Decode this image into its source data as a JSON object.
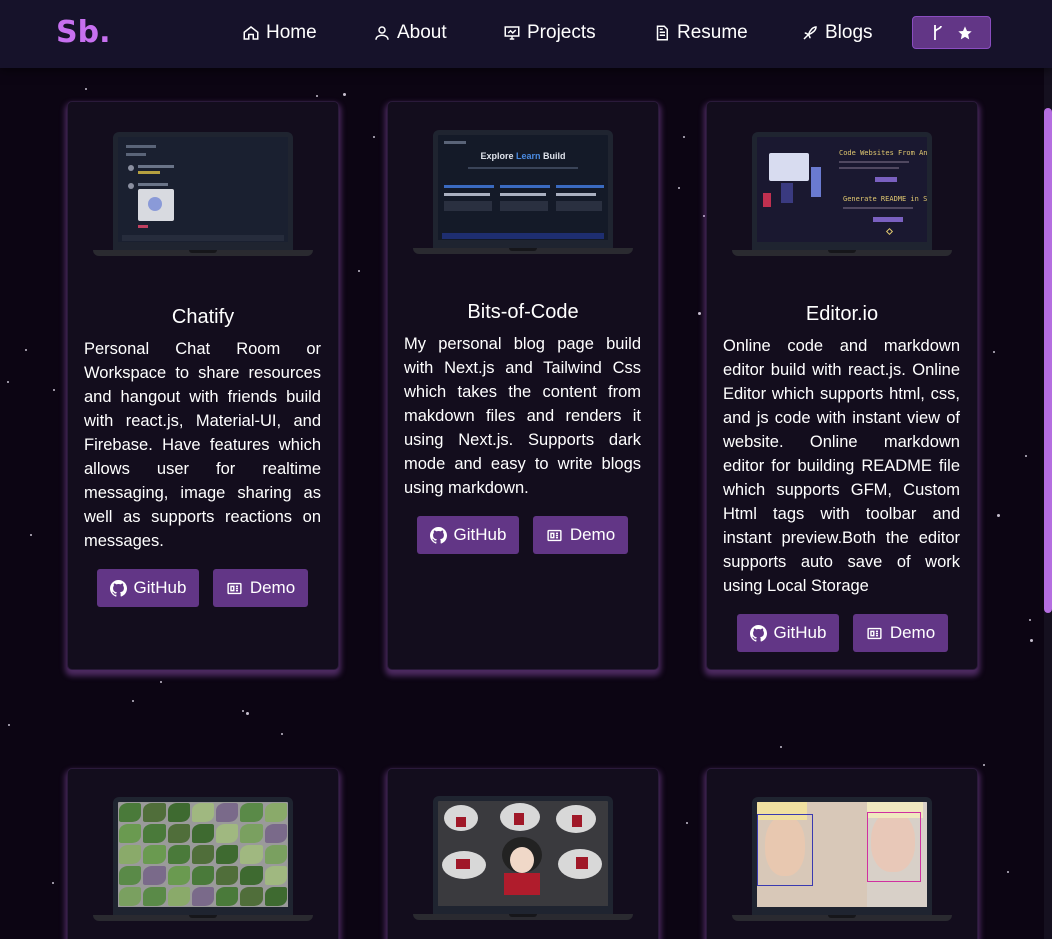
{
  "brand": {
    "name": "Sb",
    "dot": "."
  },
  "nav": [
    {
      "label": "Home",
      "icon": "home-icon"
    },
    {
      "label": "About",
      "icon": "user-icon"
    },
    {
      "label": "Projects",
      "icon": "projects-icon"
    },
    {
      "label": "Resume",
      "icon": "document-icon"
    },
    {
      "label": "Blogs",
      "icon": "blog-icon"
    }
  ],
  "nav_button": {
    "icons": [
      "fork-icon",
      "star-icon"
    ]
  },
  "colors": {
    "accent": "#c770f0",
    "button": "#623686",
    "background": "#0c0513",
    "card": "#130d1d"
  },
  "projects": [
    {
      "title": "Chatify",
      "description": "Personal Chat Room or Workspace to share resources and hangout with friends build with react.js, Material-UI, and Firebase. Have features which allows user for realtime messaging, image sharing as well as supports reactions on messages.",
      "github_label": "GitHub",
      "demo_label": "Demo"
    },
    {
      "title": "Bits-of-Code",
      "description": "My personal blog page build with Next.js and Tailwind Css which takes the content from makdown files and renders it using Next.js. Supports dark mode and easy to write blogs using markdown.",
      "github_label": "GitHub",
      "demo_label": "Demo",
      "screen_text": {
        "explore": "Explore",
        "learn": "Learn",
        "build": "Build"
      }
    },
    {
      "title": "Editor.io",
      "description": "Online code and markdown editor build with react.js. Online Editor which supports html, css, and js code with instant view of website. Online markdown editor for building README file which supports GFM, Custom Html tags with toolbar and instant preview.Both the editor supports auto save of work using Local Storage",
      "github_label": "GitHub",
      "demo_label": "Demo",
      "screen_text": {
        "heading1": "Code Websites From Any W",
        "heading2": "Generate README in Seco"
      }
    }
  ]
}
